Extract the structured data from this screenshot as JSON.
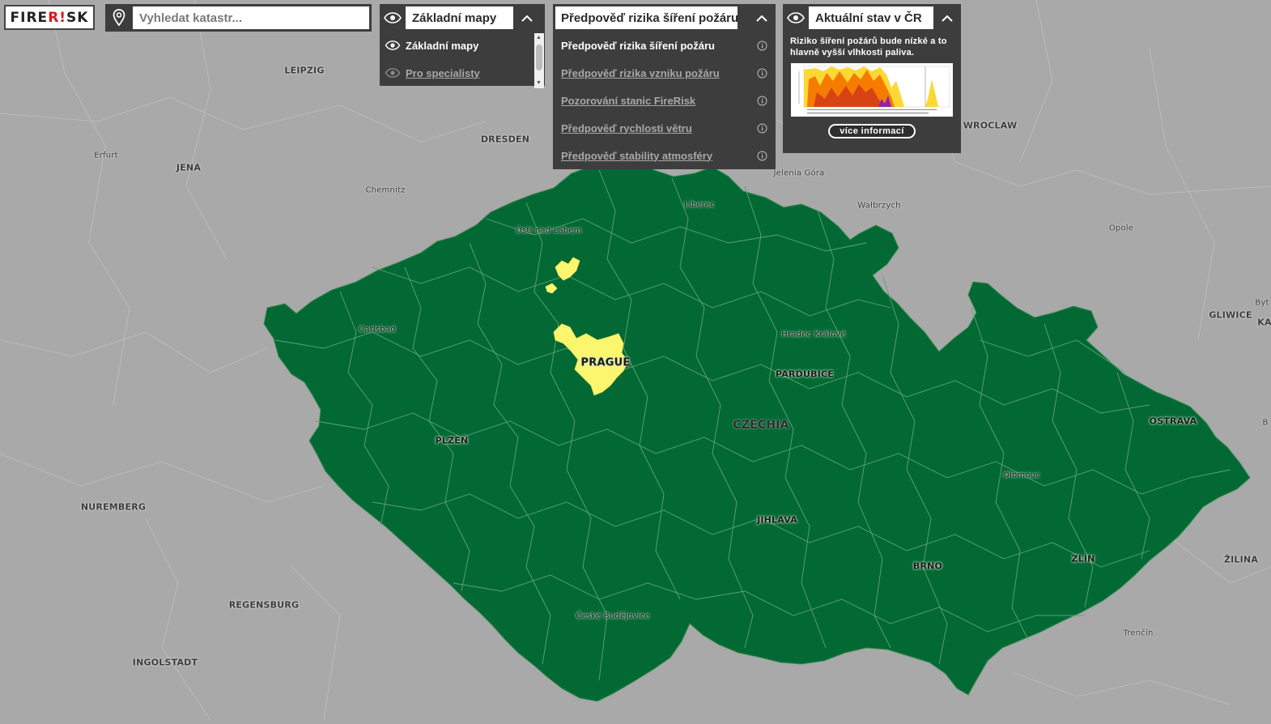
{
  "app": {
    "logo_left": "FIRE",
    "logo_mark": "R!",
    "logo_right": "SK"
  },
  "search": {
    "placeholder": "Vyhledat katastr..."
  },
  "basemaps": {
    "title": "Základní mapy",
    "items": [
      {
        "label": "Základní mapy",
        "active": true
      },
      {
        "label": "Pro specialisty",
        "active": false
      }
    ]
  },
  "layers": {
    "title": "Předpověď rizika šíření požáru",
    "items": [
      {
        "label": "Předpověď rizika šíření požáru",
        "active": true
      },
      {
        "label": "Předpověď rizika vzniku požáru",
        "active": false
      },
      {
        "label": "Pozorování stanic FireRisk",
        "active": false
      },
      {
        "label": "Předpověď rychlosti větru",
        "active": false
      },
      {
        "label": "Předpověď stability atmosféry",
        "active": false
      }
    ]
  },
  "status": {
    "title": "Aktuální stav v ČR",
    "text": "Riziko šíření požárů bude nízké a to hlavně vyšší vlhkosti paliva.",
    "button": "více informací"
  },
  "colors": {
    "map_background": "#a9a9a9",
    "risk_low": "#026934",
    "risk_moderate": "#fbf66e",
    "panel_bg": "#3d3d3d",
    "brand_red": "#e0151c"
  },
  "map": {
    "labels_outside": [
      {
        "text": "LEIPZIG",
        "style": "big"
      },
      {
        "text": "Erfurt",
        "style": "small"
      },
      {
        "text": "JENA",
        "style": "big"
      },
      {
        "text": "DRESDEN",
        "style": "big"
      },
      {
        "text": "Chemnitz",
        "style": "small"
      },
      {
        "text": "Jelenia Góra",
        "style": "small"
      },
      {
        "text": "Wałbrzych",
        "style": "small"
      },
      {
        "text": "WROCLAW",
        "style": "big"
      },
      {
        "text": "Opole",
        "style": "small"
      },
      {
        "text": "GLIWICE",
        "style": "big"
      },
      {
        "text": "Byt",
        "style": "small"
      },
      {
        "text": "KA",
        "style": "big"
      },
      {
        "text": "B",
        "style": "small"
      },
      {
        "text": "NUREMBERG",
        "style": "big"
      },
      {
        "text": "REGENSBURG",
        "style": "big"
      },
      {
        "text": "INGOLSTADT",
        "style": "big"
      },
      {
        "text": "ŽILINA",
        "style": "big"
      },
      {
        "text": "Trenčín",
        "style": "small"
      }
    ],
    "labels_inside": [
      {
        "text": "Liberec",
        "style": "small"
      },
      {
        "text": "Ústí nad Labem",
        "style": "small"
      },
      {
        "text": "Carlsbad",
        "style": "small"
      },
      {
        "text": "PRAGUE",
        "style": "big"
      },
      {
        "text": "Hradec Králové",
        "style": "small"
      },
      {
        "text": "PARDUBICE",
        "style": "big"
      },
      {
        "text": "CZECHIA",
        "style": "country"
      },
      {
        "text": "PLZEŇ",
        "style": "big"
      },
      {
        "text": "OSTRAVA",
        "style": "big"
      },
      {
        "text": "Olomouc",
        "style": "small"
      },
      {
        "text": "JIHLAVA",
        "style": "big"
      },
      {
        "text": "ZLÍN",
        "style": "big"
      },
      {
        "text": "BRNO",
        "style": "big"
      },
      {
        "text": "České Budějovice",
        "style": "small"
      }
    ]
  }
}
